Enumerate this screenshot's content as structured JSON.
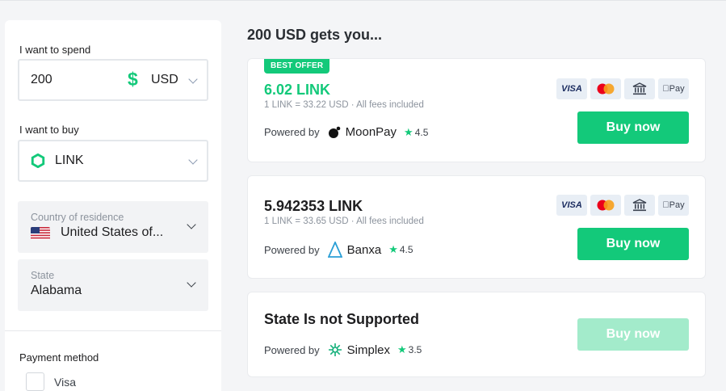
{
  "sidebar": {
    "spend_label": "I want to spend",
    "spend_value": "200",
    "spend_currency": "USD",
    "buy_label": "I want to buy",
    "buy_coin": "LINK",
    "country_label": "Country of residence",
    "country_value": "United States of...",
    "state_label": "State",
    "state_value": "Alabama",
    "payment_label": "Payment method",
    "payment_option": "Visa"
  },
  "main": {
    "title": "200 USD gets you...",
    "offers": [
      {
        "badge": "BEST OFFER",
        "amount": "6.02 LINK",
        "rate": "1 LINK = 33.22 USD · All fees included",
        "powered_by": "Powered by",
        "provider": "MoonPay",
        "star": "★",
        "rating": "4.5",
        "button": "Buy now"
      },
      {
        "amount": "5.942353 LINK",
        "rate": "1 LINK = 33.65 USD · All fees included",
        "powered_by": "Powered by",
        "provider": "Banxa",
        "star": "★",
        "rating": "4.5",
        "button": "Buy now"
      },
      {
        "message": "State Is not Supported",
        "powered_by": "Powered by",
        "provider": "Simplex",
        "star": "★",
        "rating": "3.5",
        "button": "Buy now"
      }
    ],
    "payment_icons": {
      "visa": "VISA",
      "mastercard": "mastercard-icon",
      "bank": "bank-icon",
      "applepay": "Pay"
    }
  },
  "colors": {
    "accent": "#13c97a",
    "accent_disabled": "#a3ebcb",
    "background": "#f4f5f7"
  }
}
